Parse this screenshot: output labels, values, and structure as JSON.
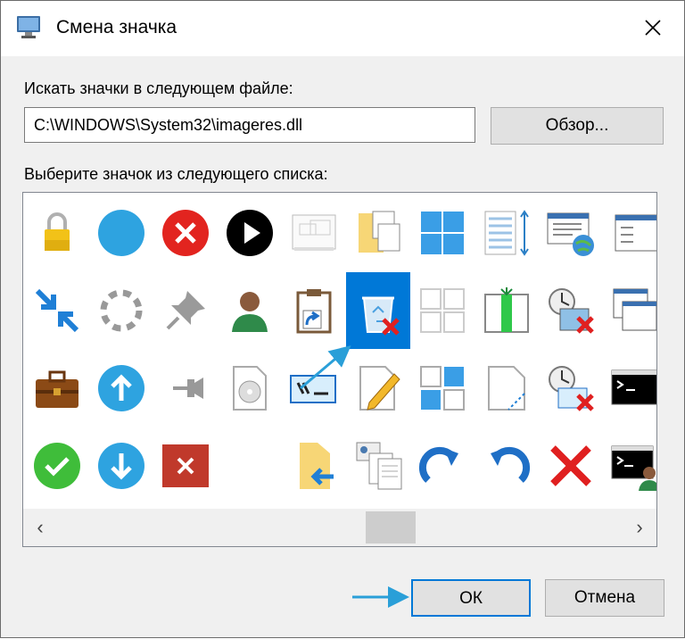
{
  "window": {
    "title": "Смена значка",
    "close_glyph": "✕"
  },
  "file_label": "Искать значки в следующем файле:",
  "file_path": "C:\\WINDOWS\\System32\\imageres.dll",
  "browse_label": "Обзор...",
  "list_label": "Выберите значок из следующего списка:",
  "icons": [
    [
      "lock-icon",
      "circle-blue-icon",
      "error-icon",
      "play-icon",
      "window-frame-icon",
      "folder-copy-icon",
      "grid-tiles-icon",
      "list-resize-icon",
      "web-window-icon",
      "window-edge-icon"
    ],
    [
      "shrink-arrows-icon",
      "loading-ring-icon",
      "pin-icon",
      "user-icon",
      "clipboard-shortcut-icon",
      "recycle-bin-full-icon",
      "grid-outline-icon",
      "column-green-icon",
      "clock-window-error-icon",
      "windows-stack-icon"
    ],
    [
      "briefcase-icon",
      "upload-arrow-icon",
      "pushpin-icon",
      "disc-document-icon",
      "cmd-shortcut-icon",
      "pencil-document-icon",
      "grid-blue-icon",
      "page-corner-icon",
      "clock-cmd-error-icon",
      "console-icon"
    ],
    [
      "check-icon",
      "download-arrow-icon",
      "delete-box-icon",
      "blank-icon",
      "folder-import-icon",
      "contact-documents-icon",
      "redo-icon",
      "undo-icon",
      "red-x-icon",
      "console-user-icon"
    ]
  ],
  "selected_icon": "recycle-bin-full-icon",
  "scroll_left_glyph": "‹",
  "scroll_right_glyph": "›",
  "ok_label": "ОК",
  "cancel_label": "Отмена",
  "colors": {
    "accent": "#0078d7",
    "dialog_bg": "#f0f0f0",
    "button_bg": "#e1e1e1",
    "arrow": "#2a9fd8"
  }
}
